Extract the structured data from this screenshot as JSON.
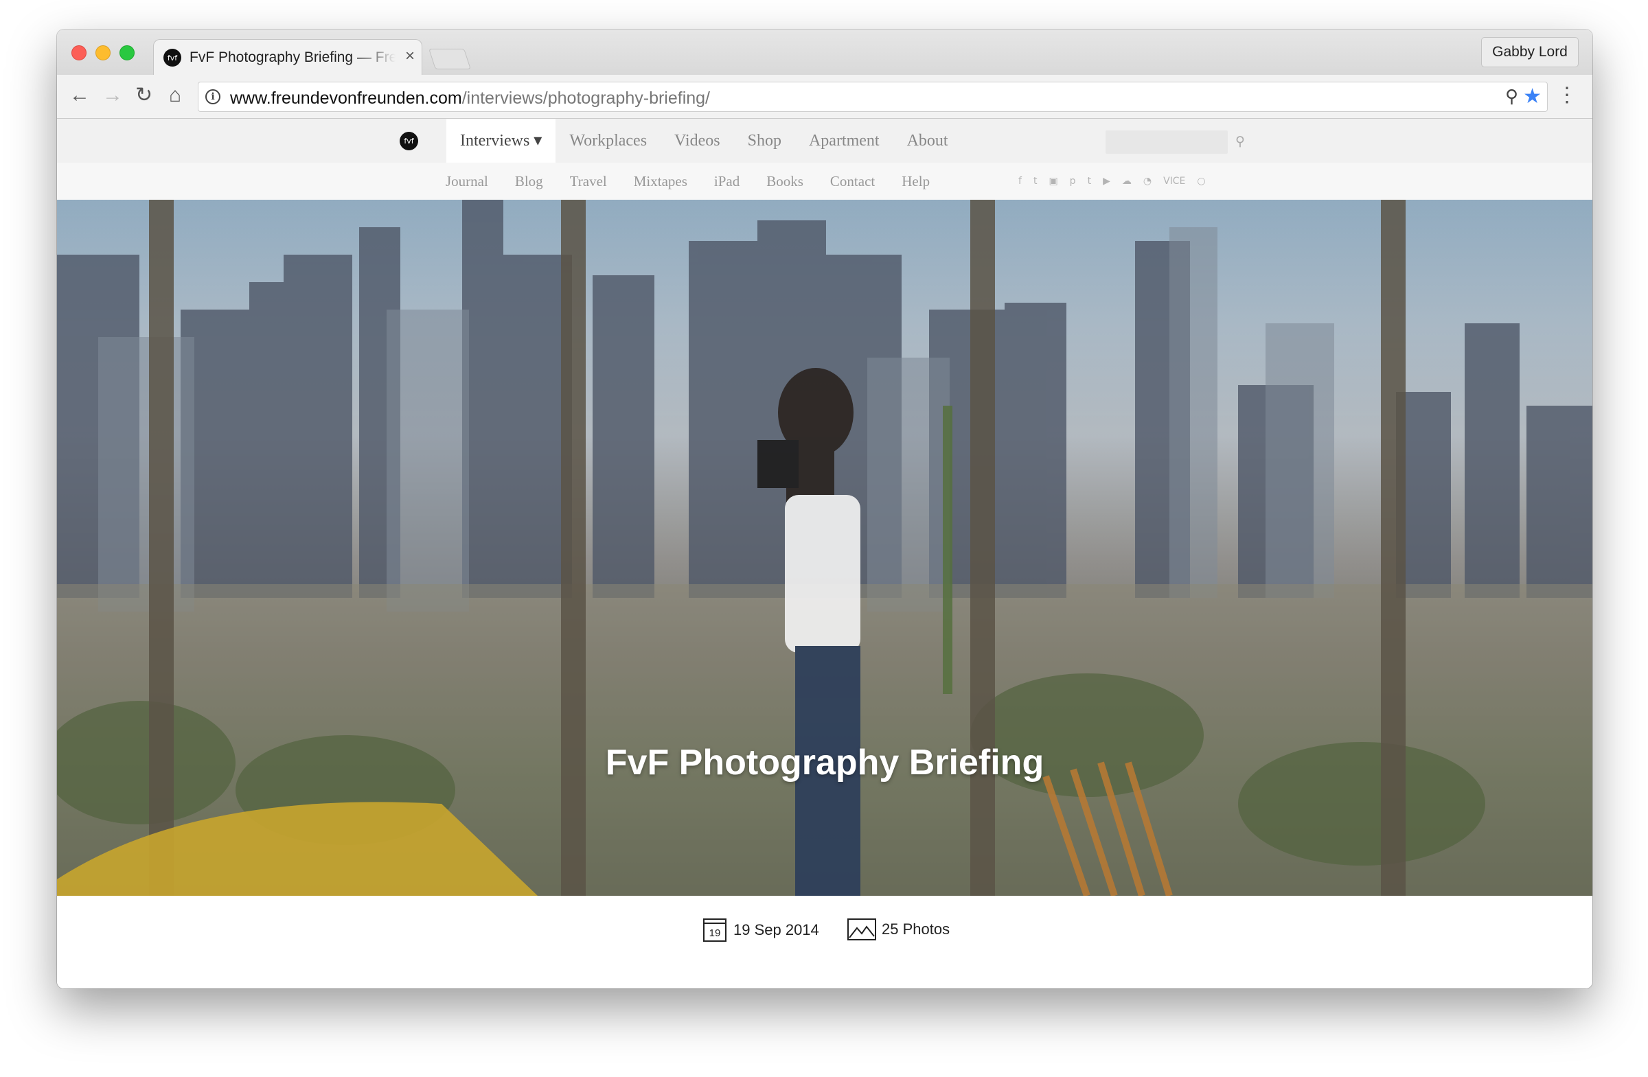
{
  "browser": {
    "tab_title": "FvF Photography Briefing — Freunde von Freunden",
    "tab_favicon": "fvf",
    "profile_name": "Gabby Lord",
    "url_host": "www.freundevonfreunden.com",
    "url_path": "/interviews/photography-briefing/",
    "icons": {
      "back": "←",
      "forward": "→",
      "reload": "↻",
      "home": "⌂",
      "info": "i",
      "zoom": "⚲",
      "bookmark": "★",
      "menu": "⋮",
      "close": "×"
    }
  },
  "site": {
    "logo": "fvf",
    "main_nav": [
      {
        "label": "Interviews ▾",
        "active": true
      },
      {
        "label": "Workplaces"
      },
      {
        "label": "Videos"
      },
      {
        "label": "Shop"
      },
      {
        "label": "Apartment"
      },
      {
        "label": "About"
      }
    ],
    "sub_nav": [
      "Journal",
      "Blog",
      "Travel",
      "Mixtapes",
      "iPad",
      "Books",
      "Contact",
      "Help"
    ],
    "social": [
      "f",
      "t",
      "▣",
      "p",
      "t",
      "▶",
      "☁",
      "◔",
      "VICE",
      "○"
    ],
    "search_icon": "⚲"
  },
  "hero": {
    "title": "FvF Photography Briefing"
  },
  "meta": {
    "date_day": "19",
    "date": "19 Sep 2014",
    "photos": "25 Photos"
  }
}
